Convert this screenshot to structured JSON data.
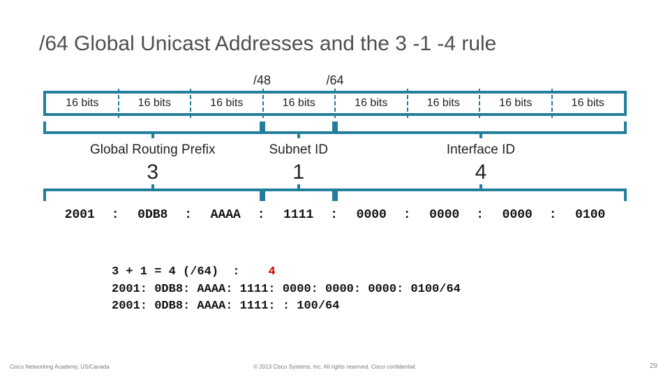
{
  "title": "/64 Global Unicast Addresses and the 3 -1 -4 rule",
  "prefix48": "/48",
  "prefix64": "/64",
  "bits": [
    "16 bits",
    "16 bits",
    "16 bits",
    "16 bits",
    "16 bits",
    "16 bits",
    "16 bits",
    "16 bits"
  ],
  "seg": {
    "grp": "Global Routing Prefix",
    "sub": "Subnet ID",
    "iid": "Interface ID"
  },
  "rule": {
    "a": "3",
    "b": "1",
    "c": "4"
  },
  "hex": [
    "2001",
    "0DB8",
    "AAAA",
    "1111",
    "0000",
    "0000",
    "0000",
    "0100"
  ],
  "colon": ":",
  "summary": {
    "line1a": "3 + 1 = 4 (/64)  :    ",
    "line1b": "4",
    "line2": "2001: 0DB8: AAAA: 1111: 0000: 0000: 0000: 0100/64",
    "line3": "2001: 0DB8: AAAA: 1111: : 100/64"
  },
  "footer": {
    "left": "Cisco Networking Academy, US/Canada",
    "mid": "© 2013 Cisco Systems, Inc. All rights reserved. Cisco confidential.",
    "right": "29"
  }
}
